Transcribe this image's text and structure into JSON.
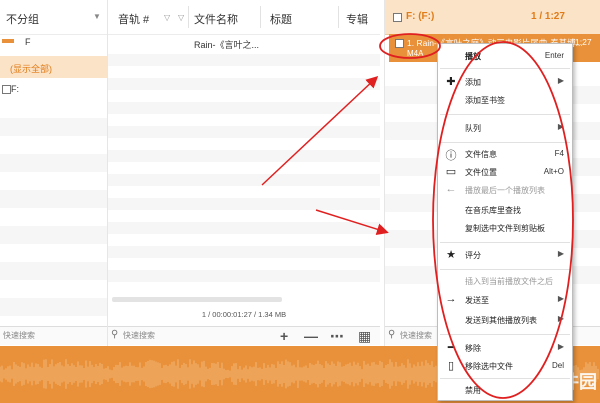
{
  "left_panel": {
    "header_title": "不分组",
    "group_f": "F",
    "show_all": "(显示全部)",
    "drive_f": "F:",
    "search_placeholder": "快速搜索"
  },
  "middle_panel": {
    "columns": [
      "音轨 #",
      "文件名称",
      "标题",
      "专辑"
    ],
    "row1_filename": "Rain-《言叶之...",
    "status_text": "1 / 00:00:01:27 / 1.34 MB",
    "search_placeholder": "快速搜索",
    "toolbar": {
      "add": "+",
      "remove": "—",
      "menu": "⋯",
      "grid": "▦"
    }
  },
  "right_panel": {
    "header_title": "F: (F:)",
    "header_duration": "1 / 1:27",
    "selected_line1": "1. Rain-《言叶之庭》动画电影片尾曲-秦基博...",
    "selected_line2": "M4A",
    "selected_duration": "1:27",
    "search_placeholder": "快速搜索"
  },
  "context_menu": {
    "items": [
      {
        "label": "播放",
        "shortcut": "Enter"
      },
      {
        "label": "添加",
        "submenu": true
      },
      {
        "label": "添加至书签"
      },
      {
        "label": "队列",
        "submenu": true
      },
      {
        "label": "文件信息",
        "shortcut": "F4"
      },
      {
        "label": "文件位置",
        "shortcut": "Alt+O"
      },
      {
        "label": "播放最后一个播放列表",
        "disabled": true
      },
      {
        "label": "在音乐库里查找"
      },
      {
        "label": "复制选中文件到剪贴板"
      },
      {
        "label": "评分",
        "submenu": true
      },
      {
        "label": "插入到当前播放文件之后",
        "disabled": true
      },
      {
        "label": "发送至",
        "submenu": true
      },
      {
        "label": "发送到其他播放列表",
        "submenu": true
      },
      {
        "label": "移除",
        "submenu": true
      },
      {
        "label": "移除选中文件",
        "shortcut": "Del"
      },
      {
        "label": "禁用"
      }
    ]
  },
  "watermark": "软件园",
  "colors": {
    "accent": "#e8913a",
    "highlight": "#fbe3c7",
    "annotation": "#e02020"
  }
}
